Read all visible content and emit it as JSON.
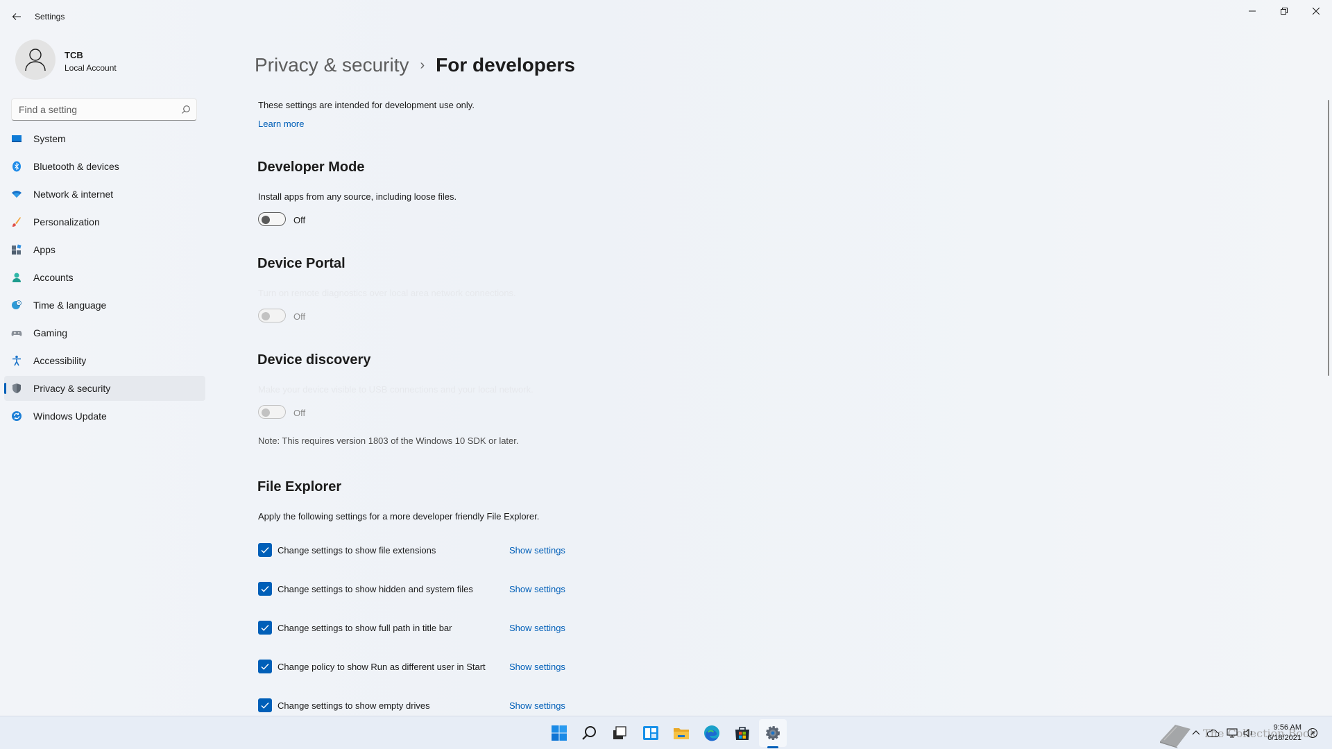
{
  "app": {
    "title": "Settings"
  },
  "profile": {
    "name": "TCB",
    "account_type": "Local Account"
  },
  "search": {
    "placeholder": "Find a setting"
  },
  "sidebar": {
    "items": [
      {
        "label": "System",
        "icon": "monitor-icon"
      },
      {
        "label": "Bluetooth & devices",
        "icon": "bluetooth-icon"
      },
      {
        "label": "Network & internet",
        "icon": "wifi-icon"
      },
      {
        "label": "Personalization",
        "icon": "brush-icon"
      },
      {
        "label": "Apps",
        "icon": "apps-icon"
      },
      {
        "label": "Accounts",
        "icon": "person-icon"
      },
      {
        "label": "Time & language",
        "icon": "globe-clock-icon"
      },
      {
        "label": "Gaming",
        "icon": "gamepad-icon"
      },
      {
        "label": "Accessibility",
        "icon": "accessibility-icon"
      },
      {
        "label": "Privacy & security",
        "icon": "shield-icon",
        "selected": true
      },
      {
        "label": "Windows Update",
        "icon": "refresh-icon"
      }
    ]
  },
  "breadcrumb": {
    "parent": "Privacy & security",
    "separator": "›",
    "current": "For developers"
  },
  "intro": {
    "text": "These settings are intended for development use only.",
    "link": "Learn more"
  },
  "developer_mode": {
    "title": "Developer Mode",
    "description": "Install apps from any source, including loose files.",
    "state": "Off"
  },
  "device_portal": {
    "title": "Device Portal",
    "description": "Turn on remote diagnostics over local area network connections.",
    "state": "Off"
  },
  "device_discovery": {
    "title": "Device discovery",
    "description": "Make your device visible to USB connections and your local network.",
    "state": "Off",
    "note": "Note: This requires version 1803 of the Windows 10 SDK or later."
  },
  "file_explorer": {
    "title": "File Explorer",
    "description": "Apply the following settings for a more developer friendly File Explorer.",
    "options": [
      {
        "label": "Change settings to show file extensions",
        "link": "Show settings",
        "checked": true
      },
      {
        "label": "Change settings to show hidden and system files",
        "link": "Show settings",
        "checked": true
      },
      {
        "label": "Change settings to show full path in title bar",
        "link": "Show settings",
        "checked": true
      },
      {
        "label": "Change policy to show Run as different user in Start",
        "link": "Show settings",
        "checked": true
      },
      {
        "label": "Change settings to show empty drives",
        "link": "Show settings",
        "checked": true
      }
    ]
  },
  "taskbar": {
    "apps": [
      "start-icon",
      "search-icon",
      "task-view-icon",
      "widgets-icon",
      "file-explorer-icon",
      "edge-icon",
      "store-icon",
      "settings-icon"
    ],
    "active_app": "settings-icon",
    "clock": {
      "time": "9:56 AM",
      "date": "6/18/2021"
    },
    "watermark": "The Collection Book"
  },
  "colors": {
    "accent": "#005fb8",
    "background": "#f3f3f3",
    "taskbar": "#e7edf6"
  }
}
